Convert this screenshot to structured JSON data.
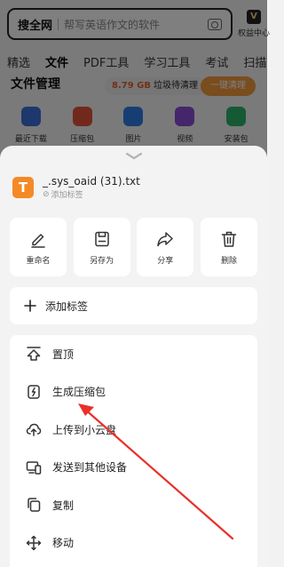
{
  "search": {
    "brand": "搜全网",
    "placeholder": "帮写英语作文的软件"
  },
  "vip": {
    "badge": "V",
    "label": "权益中心"
  },
  "tabs": [
    "精选",
    "文件",
    "PDF工具",
    "学习工具",
    "考试",
    "扫描"
  ],
  "file_manager": {
    "title": "文件管理",
    "storage_amount": "8.79 GB",
    "storage_text": "垃圾待清理",
    "clean_button": "一键清理"
  },
  "categories": [
    {
      "label": "最近下载",
      "color": "#3d6fd8"
    },
    {
      "label": "压缩包",
      "color": "#e2523b"
    },
    {
      "label": "图片",
      "color": "#2f7de6"
    },
    {
      "label": "视频",
      "color": "#8a4cd6"
    },
    {
      "label": "安装包",
      "color": "#2bb46a"
    }
  ],
  "sheet": {
    "file": {
      "icon_letter": "T",
      "name": "_.sys_oaid (31).txt",
      "tag_label": "添加标签"
    },
    "actions": [
      {
        "label": "重命名",
        "icon": "pen-icon"
      },
      {
        "label": "另存为",
        "icon": "save-icon"
      },
      {
        "label": "分享",
        "icon": "share-icon"
      },
      {
        "label": "删除",
        "icon": "trash-icon"
      }
    ],
    "add_tag": "添加标签",
    "menu": [
      {
        "label": "置顶",
        "icon": "pin-top-icon"
      },
      {
        "label": "生成压缩包",
        "icon": "zip-icon"
      },
      {
        "label": "上传到小云盘",
        "icon": "cloud-upload-icon"
      },
      {
        "label": "发送到其他设备",
        "icon": "devices-icon"
      },
      {
        "label": "复制",
        "icon": "copy-icon"
      },
      {
        "label": "移动",
        "icon": "move-icon"
      }
    ]
  },
  "colors": {
    "accent_orange": "#f48a26",
    "annotation_arrow": "#e8312a"
  }
}
